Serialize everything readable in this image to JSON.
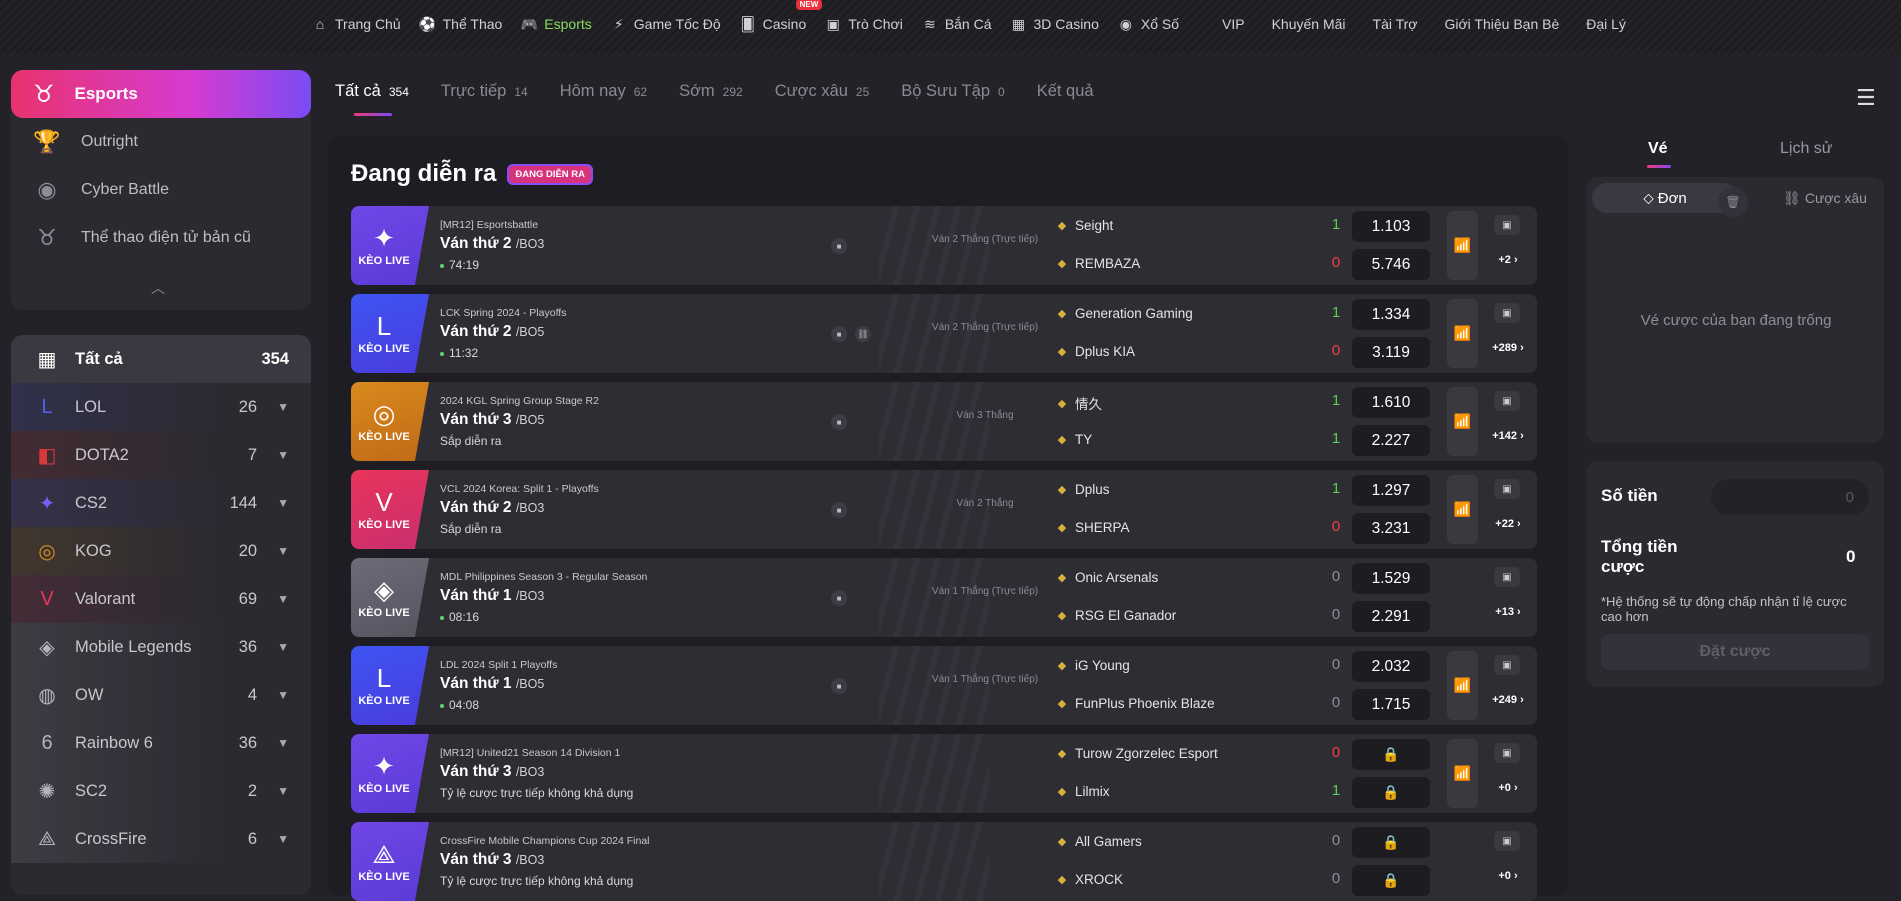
{
  "nav": {
    "left": [
      {
        "label": "Trang Chủ",
        "icon": "home-icon"
      },
      {
        "label": "Thể Thao",
        "icon": "soccer-ball-icon"
      },
      {
        "label": "Esports",
        "icon": "gamepad-icon",
        "active": true
      },
      {
        "label": "Game Tốc Độ",
        "icon": "speed-icon"
      },
      {
        "label": "Casino",
        "icon": "cards-icon",
        "badge": "NEW"
      },
      {
        "label": "Trò Chơi",
        "icon": "arcade-icon"
      },
      {
        "label": "Bắn Cá",
        "icon": "fish-icon"
      },
      {
        "label": "3D Casino",
        "icon": "grid-icon"
      },
      {
        "label": "Xổ Số",
        "icon": "lottery-icon"
      }
    ],
    "right": [
      "VIP",
      "Khuyến Mãi",
      "Tài Trợ",
      "Giới Thiệu Bạn Bè",
      "Đại Lý"
    ]
  },
  "sidebar": {
    "header": "Esports",
    "items": [
      "Outright",
      "Cyber Battle",
      "Thể thao điện tử bản cũ"
    ],
    "categories": [
      {
        "name": "Tất cả",
        "count": "354",
        "color": "#ffffff",
        "glyph": "▦"
      },
      {
        "name": "LOL",
        "count": "26",
        "color": "#5a5ef0",
        "glyph": "L"
      },
      {
        "name": "DOTA2",
        "count": "7",
        "color": "#d9383b",
        "glyph": "◧"
      },
      {
        "name": "CS2",
        "count": "144",
        "color": "#7b5ef0",
        "glyph": "✦"
      },
      {
        "name": "KOG",
        "count": "20",
        "color": "#d88a1e",
        "glyph": "◎"
      },
      {
        "name": "Valorant",
        "count": "69",
        "color": "#e6375a",
        "glyph": "V"
      },
      {
        "name": "Mobile Legends",
        "count": "36",
        "color": "#b4b4bc",
        "glyph": "◈"
      },
      {
        "name": "OW",
        "count": "4",
        "color": "#b4b4bc",
        "glyph": "◍"
      },
      {
        "name": "Rainbow 6",
        "count": "36",
        "color": "#b4b4bc",
        "glyph": "6"
      },
      {
        "name": "SC2",
        "count": "2",
        "color": "#b4b4bc",
        "glyph": "✺"
      },
      {
        "name": "CrossFire",
        "count": "6",
        "color": "#b4b4bc",
        "glyph": "⟁"
      }
    ]
  },
  "tabs": [
    {
      "label": "Tất cả",
      "count": "354"
    },
    {
      "label": "Trực tiếp",
      "count": "14"
    },
    {
      "label": "Hôm nay",
      "count": "62"
    },
    {
      "label": "Sớm",
      "count": "292"
    },
    {
      "label": "Cược xâu",
      "count": "25"
    },
    {
      "label": "Bộ Sưu Tập",
      "count": "0"
    },
    {
      "label": "Kết quả",
      "count": ""
    }
  ],
  "section": {
    "title": "Đang diễn ra",
    "badge": "ĐANG DIỄN RA"
  },
  "keo_live": "KÈO LIVE",
  "matches": [
    {
      "game": "cs",
      "league": "[MR12] Esportsbattle",
      "round": "Ván thứ 2",
      "bo": "/BO3",
      "time": "74:19",
      "live": true,
      "link": false,
      "state": "Ván 2 Thắng (Trực tiếp)",
      "team1": "Seight",
      "team2": "REMBAZA",
      "s1": "1",
      "s2": "0",
      "c1": "green",
      "c2": "red",
      "o1": "1.103",
      "o2": "5.746",
      "chart": true,
      "more": "+2"
    },
    {
      "game": "lol",
      "league": "LCK Spring 2024 - Playoffs",
      "round": "Ván thứ 2",
      "bo": "/BO5",
      "time": "11:32",
      "live": true,
      "link": true,
      "state": "Ván 2 Thắng (Trực tiếp)",
      "team1": "Generation Gaming",
      "team2": "Dplus KIA",
      "s1": "1",
      "s2": "0",
      "c1": "green",
      "c2": "red",
      "o1": "1.334",
      "o2": "3.119",
      "chart": true,
      "more": "+289"
    },
    {
      "game": "kog",
      "league": "2024 KGL Spring Group Stage R2",
      "round": "Ván thứ 3",
      "bo": "/BO5",
      "time": "Sắp diễn ra",
      "live": false,
      "link": false,
      "state": "Ván 3 Thắng",
      "team1": "情久",
      "team2": "TY",
      "s1": "1",
      "s2": "1",
      "c1": "green",
      "c2": "green",
      "o1": "1.610",
      "o2": "2.227",
      "chart": true,
      "more": "+142"
    },
    {
      "game": "val",
      "league": "VCL 2024 Korea: Split 1 - Playoffs",
      "round": "Ván thứ 2",
      "bo": "/BO3",
      "time": "Sắp diễn ra",
      "live": false,
      "link": false,
      "state": "Ván 2 Thắng",
      "team1": "Dplus",
      "team2": "SHERPA",
      "s1": "1",
      "s2": "0",
      "c1": "green",
      "c2": "red",
      "o1": "1.297",
      "o2": "3.231",
      "chart": true,
      "more": "+22"
    },
    {
      "game": "ml",
      "league": "MDL Philippines Season 3 - Regular Season",
      "round": "Ván thứ 1",
      "bo": "/BO3",
      "time": "08:16",
      "live": true,
      "link": false,
      "state": "Ván 1 Thắng (Trực tiếp)",
      "team1": "Onic Arsenals",
      "team2": "RSG El Ganador",
      "s1": "0",
      "s2": "0",
      "c1": "grey",
      "c2": "grey",
      "o1": "1.529",
      "o2": "2.291",
      "chart": false,
      "more": "+13"
    },
    {
      "game": "lol",
      "league": "LDL 2024 Split 1 Playoffs",
      "round": "Ván thứ 1",
      "bo": "/BO5",
      "time": "04:08",
      "live": true,
      "link": false,
      "state": "Ván 1 Thắng (Trực tiếp)",
      "team1": "iG Young",
      "team2": "FunPlus Phoenix Blaze",
      "s1": "0",
      "s2": "0",
      "c1": "grey",
      "c2": "grey",
      "o1": "2.032",
      "o2": "1.715",
      "chart": true,
      "more": "+249"
    },
    {
      "game": "cs",
      "league": "[MR12] United21 Season 14 Division 1",
      "round": "Ván thứ 3",
      "bo": "/BO3",
      "time": "Tỷ lệ cược trực tiếp không khả dụng",
      "live": false,
      "link": false,
      "state": "",
      "team1": "Turow Zgorzelec Esport",
      "team2": "Lilmix",
      "s1": "0",
      "s2": "1",
      "c1": "red",
      "c2": "green",
      "o1": "",
      "o2": "",
      "chart": true,
      "more": "+0"
    },
    {
      "game": "cf",
      "league": "CrossFire Mobile Champions Cup 2024 Final",
      "round": "Ván thứ 3",
      "bo": "/BO3",
      "time": "Tỷ lệ cược trực tiếp không khả dụng",
      "live": false,
      "link": false,
      "state": "",
      "team1": "All Gamers",
      "team2": "XROCK",
      "s1": "0",
      "s2": "0",
      "c1": "grey",
      "c2": "grey",
      "o1": "",
      "o2": "",
      "chart": false,
      "more": "+0"
    }
  ],
  "slip": {
    "tab_ticket": "Vé",
    "tab_history": "Lịch sử",
    "single": "Đơn",
    "parlay": "Cược xâu",
    "empty": "Vé cược của bạn đang trống",
    "amount_label": "Số tiền",
    "amount_placeholder": "0",
    "total_label": "Tổng tiền cược",
    "total_value": "0",
    "note": "*Hệ thống sẽ tự động chấp nhận tỉ lệ cược cao hơn",
    "bet_button": "Đặt cược"
  }
}
